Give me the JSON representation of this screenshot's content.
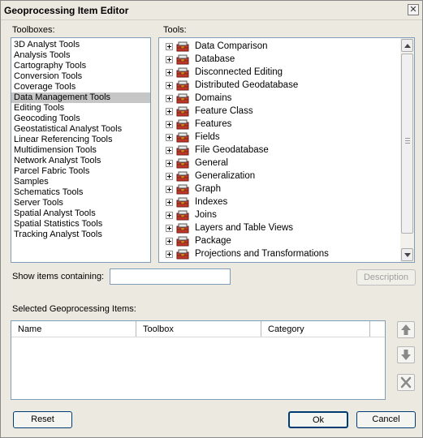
{
  "window": {
    "title": "Geoprocessing Item Editor",
    "close_glyph": "✕"
  },
  "toolboxes": {
    "label": "Toolboxes:",
    "items": [
      "3D Analyst Tools",
      "Analysis Tools",
      "Cartography Tools",
      "Conversion Tools",
      "Coverage Tools",
      "Data Management Tools",
      "Editing Tools",
      "Geocoding Tools",
      "Geostatistical Analyst Tools",
      "Linear Referencing Tools",
      "Multidimension Tools",
      "Network Analyst Tools",
      "Parcel Fabric Tools",
      "Samples",
      "Schematics Tools",
      "Server Tools",
      "Spatial Analyst Tools",
      "Spatial Statistics Tools",
      "Tracking Analyst Tools"
    ],
    "selected": "Data Management Tools"
  },
  "tools": {
    "label": "Tools:",
    "items": [
      "Data Comparison",
      "Database",
      "Disconnected Editing",
      "Distributed Geodatabase",
      "Domains",
      "Feature Class",
      "Features",
      "Fields",
      "File Geodatabase",
      "General",
      "Generalization",
      "Graph",
      "Indexes",
      "Joins",
      "Layers and Table Views",
      "Package",
      "Projections and Transformations"
    ],
    "item_icon": "toolbox-icon"
  },
  "filter": {
    "label": "Show items containing:",
    "value": "",
    "description_button": "Description"
  },
  "selected_items": {
    "label": "Selected Geoprocessing Items:",
    "columns": [
      "Name",
      "Toolbox",
      "Category"
    ],
    "rows": []
  },
  "side_buttons": {
    "up_icon": "arrow-up-icon",
    "down_icon": "arrow-down-icon",
    "remove_icon": "delete-x-icon"
  },
  "footer": {
    "reset": "Reset",
    "ok": "Ok",
    "cancel": "Cancel"
  },
  "colors": {
    "selection": "#c6c6c6",
    "border_accent": "#7f9db9",
    "toolbox_red": "#c0392b"
  }
}
